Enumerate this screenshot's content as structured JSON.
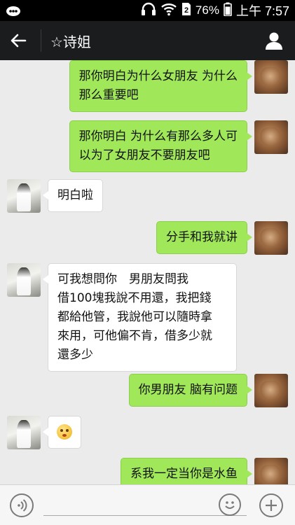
{
  "statusbar": {
    "battery_percent": "76%",
    "time": "上午 7:57",
    "icons": [
      "notification-icon",
      "headphones-icon",
      "wifi-icon",
      "sim-icon",
      "battery-icon"
    ]
  },
  "header": {
    "title": "☆诗姐",
    "back_icon": "arrow-left-icon",
    "profile_icon": "person-icon"
  },
  "messages": [
    {
      "sender": "me",
      "lines": [
        "那你明白为什么女朋友 为什么",
        "那么重要吧"
      ]
    },
    {
      "sender": "me",
      "lines": [
        "那你明白 为什么有那么多人可",
        "以为了女朋友不要朋友吧"
      ]
    },
    {
      "sender": "her",
      "lines": [
        "明白啦"
      ]
    },
    {
      "sender": "me",
      "lines": [
        "分手和我就讲"
      ]
    },
    {
      "sender": "her",
      "lines": [
        "可我想問你　男朋友問我",
        "借100塊我說不用還，我把錢",
        "都給他管，我說他可以隨時拿",
        "來用，可他偏不肯，借多少就",
        "還多少"
      ]
    },
    {
      "sender": "me",
      "lines": [
        "你男朋友 脑有问题"
      ]
    },
    {
      "sender": "her",
      "lines": [],
      "emoji": "blushing-face-emoji"
    },
    {
      "sender": "me",
      "lines": [
        "系我一定当你是水鱼"
      ]
    }
  ],
  "inputbar": {
    "voice_icon": "voice-icon",
    "emoji_icon": "smiley-icon",
    "plus_icon": "plus-icon"
  }
}
